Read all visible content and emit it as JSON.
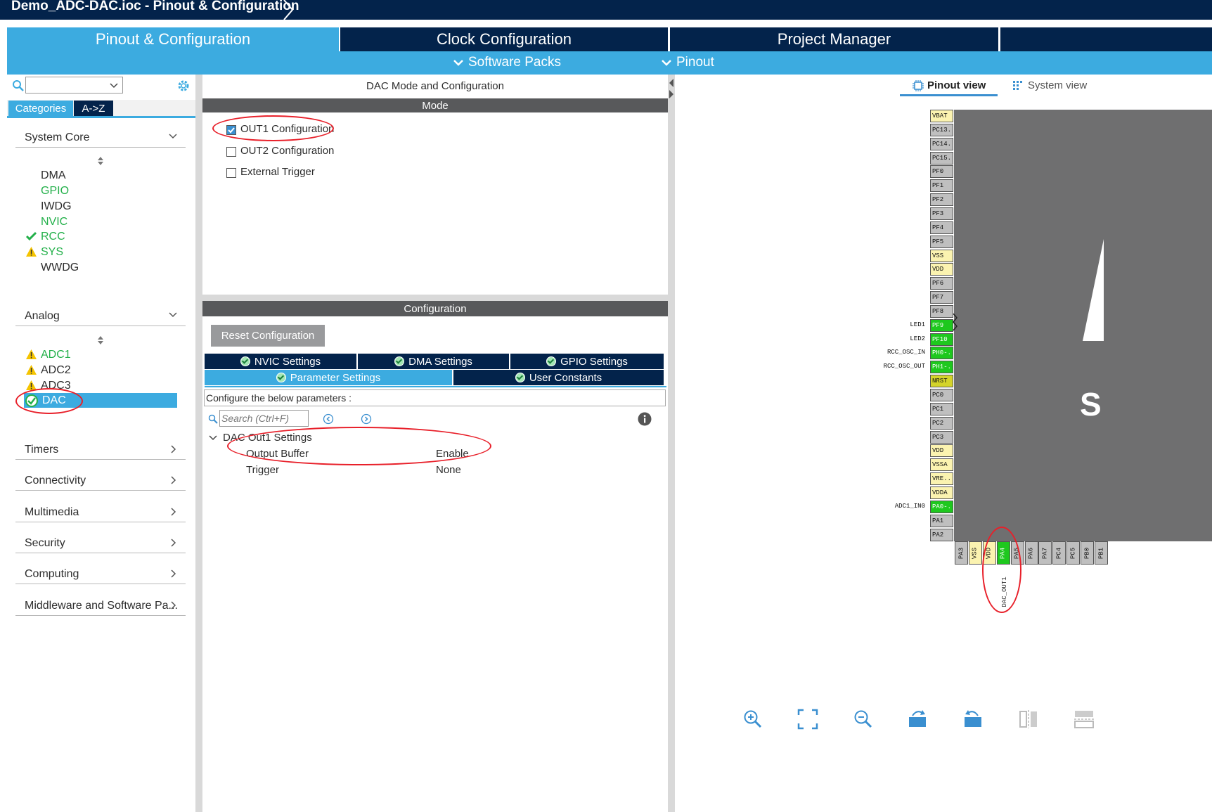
{
  "window": {
    "title": "Demo_ADC-DAC.ioc - Pinout & Configuration"
  },
  "main_tabs": [
    {
      "label": "Pinout & Configuration",
      "active": true
    },
    {
      "label": "Clock Configuration",
      "active": false
    },
    {
      "label": "Project Manager",
      "active": false
    }
  ],
  "subnav": {
    "software_packs": "Software Packs",
    "pinout": "Pinout"
  },
  "left": {
    "search_placeholder": "",
    "view_tabs": [
      "Categories",
      "A->Z"
    ],
    "system_core": {
      "label": "System Core",
      "items": [
        "DMA",
        "GPIO",
        "IWDG",
        "NVIC",
        "RCC",
        "SYS",
        "WWDG"
      ]
    },
    "analog": {
      "label": "Analog",
      "items": [
        "ADC1",
        "ADC2",
        "ADC3",
        "DAC"
      ]
    },
    "categories": [
      "Timers",
      "Connectivity",
      "Multimedia",
      "Security",
      "Computing",
      "Middleware and Software Pa..."
    ]
  },
  "middle": {
    "title": "DAC Mode and Configuration",
    "mode_header": "Mode",
    "mode_options": [
      {
        "label": "OUT1 Configuration",
        "checked": true
      },
      {
        "label": "OUT2 Configuration",
        "checked": false
      },
      {
        "label": "External Trigger",
        "checked": false
      }
    ],
    "config_header": "Configuration",
    "reset_button": "Reset Configuration",
    "tabs_row1": [
      "NVIC Settings",
      "DMA Settings",
      "GPIO Settings"
    ],
    "tabs_row2": [
      "Parameter Settings",
      "User Constants"
    ],
    "configure_text": "Configure the below parameters :",
    "search_placeholder": "Search (Ctrl+F)",
    "group_label": "DAC Out1 Settings",
    "params": [
      {
        "name": "Output Buffer",
        "value": "Enable"
      },
      {
        "name": "Trigger",
        "value": "None"
      }
    ]
  },
  "right": {
    "view_tabs": [
      "Pinout view",
      "System view"
    ],
    "chip_letter": "S",
    "left_pins": [
      {
        "name": "VBAT",
        "color": "yellow",
        "label": ""
      },
      {
        "name": "PC13..",
        "color": "grey",
        "label": ""
      },
      {
        "name": "PC14..",
        "color": "grey",
        "label": ""
      },
      {
        "name": "PC15..",
        "color": "grey",
        "label": ""
      },
      {
        "name": "PF0",
        "color": "grey",
        "label": ""
      },
      {
        "name": "PF1",
        "color": "grey",
        "label": ""
      },
      {
        "name": "PF2",
        "color": "grey",
        "label": ""
      },
      {
        "name": "PF3",
        "color": "grey",
        "label": ""
      },
      {
        "name": "PF4",
        "color": "grey",
        "label": ""
      },
      {
        "name": "PF5",
        "color": "grey",
        "label": ""
      },
      {
        "name": "VSS",
        "color": "yellow",
        "label": ""
      },
      {
        "name": "VDD",
        "color": "yellow",
        "label": ""
      },
      {
        "name": "PF6",
        "color": "grey",
        "label": ""
      },
      {
        "name": "PF7",
        "color": "grey",
        "label": ""
      },
      {
        "name": "PF8",
        "color": "grey",
        "label": ""
      },
      {
        "name": "PF9",
        "color": "green",
        "label": "LED1"
      },
      {
        "name": "PF10",
        "color": "green",
        "label": "LED2"
      },
      {
        "name": "PH0-..",
        "color": "green",
        "label": "RCC_OSC_IN"
      },
      {
        "name": "PH1-..",
        "color": "green",
        "label": "RCC_OSC_OUT"
      },
      {
        "name": "NRST",
        "color": "olive",
        "label": ""
      },
      {
        "name": "PC0",
        "color": "grey",
        "label": ""
      },
      {
        "name": "PC1",
        "color": "grey",
        "label": ""
      },
      {
        "name": "PC2",
        "color": "grey",
        "label": ""
      },
      {
        "name": "PC3",
        "color": "grey",
        "label": ""
      },
      {
        "name": "VDD",
        "color": "yellow",
        "label": ""
      },
      {
        "name": "VSSA",
        "color": "yellow",
        "label": ""
      },
      {
        "name": "VRE..",
        "color": "yellow",
        "label": ""
      },
      {
        "name": "VDDA",
        "color": "yellow",
        "label": ""
      },
      {
        "name": "PA0-..",
        "color": "green",
        "label": "ADC1_IN0"
      },
      {
        "name": "PA1",
        "color": "grey",
        "label": ""
      },
      {
        "name": "PA2",
        "color": "grey",
        "label": ""
      }
    ],
    "bottom_pins": [
      {
        "name": "PA3",
        "color": "grey"
      },
      {
        "name": "VSS",
        "color": "yellow"
      },
      {
        "name": "VDD",
        "color": "yellow"
      },
      {
        "name": "PA4",
        "color": "green"
      },
      {
        "name": "PA5",
        "color": "grey"
      },
      {
        "name": "PA6",
        "color": "grey"
      },
      {
        "name": "PA7",
        "color": "grey"
      },
      {
        "name": "PC4",
        "color": "grey"
      },
      {
        "name": "PC5",
        "color": "grey"
      },
      {
        "name": "PB0",
        "color": "grey"
      },
      {
        "name": "PB1",
        "color": "grey"
      }
    ],
    "bottom_label": "DAC_OUT1"
  },
  "colors": {
    "navy": "#03234b",
    "accent": "#3cabe0",
    "green": "#23b04a",
    "annotation": "#e8202a"
  }
}
